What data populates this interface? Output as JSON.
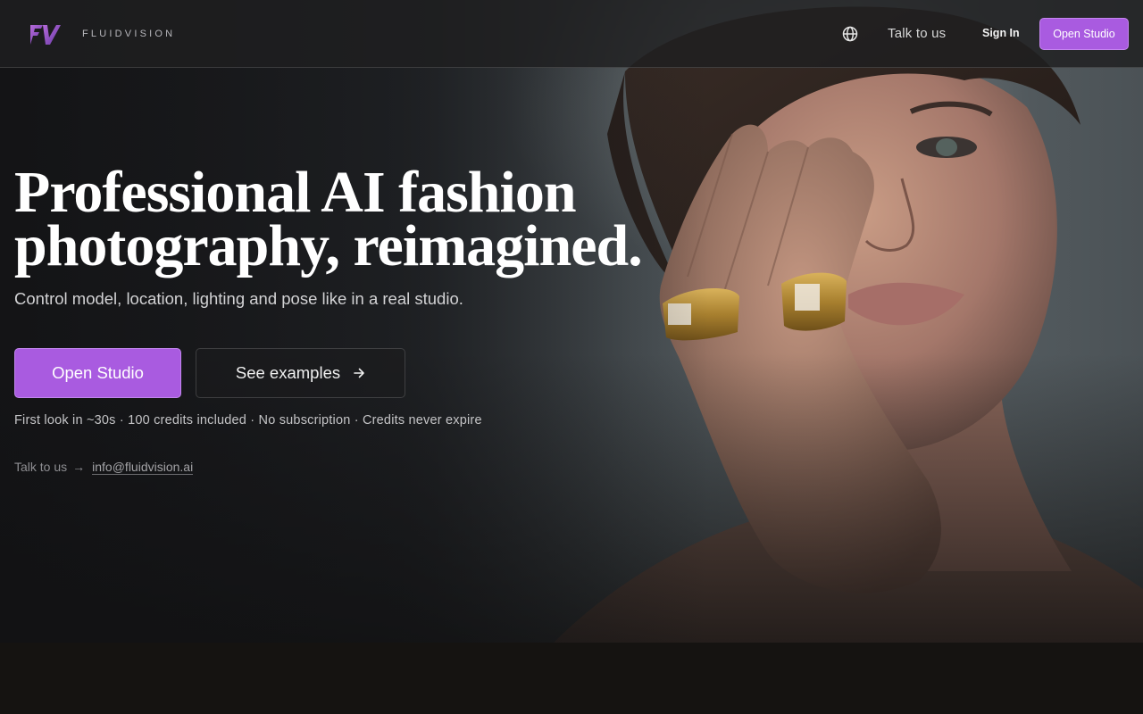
{
  "brand": {
    "name": "FLUIDVISION",
    "logo_icon": "fv-monogram-logo",
    "accent": "#a95be0"
  },
  "nav": {
    "language_icon": "globe-icon",
    "talk_label": "Talk to us",
    "signin_label": "Sign In",
    "cta_label": "Open Studio"
  },
  "hero": {
    "headline_line1": "Professional AI fashion",
    "headline_line2": "photography, reimagined.",
    "subheadline": "Control model, location, lighting and pose like in a real studio.",
    "primary_cta": "Open Studio",
    "secondary_cta": "See examples",
    "secondary_cta_icon": "arrow-right-icon",
    "features": "First look in ~30s · 100 credits included · No subscription · Credits never expire",
    "contact_label": "Talk to us",
    "contact_arrow": "→",
    "contact_email": "info@fluidvision.ai"
  }
}
